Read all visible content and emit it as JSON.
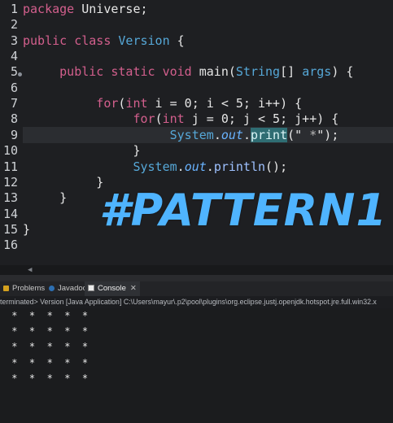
{
  "editor": {
    "lines": [
      {
        "n": "1",
        "segments": [
          {
            "t": "package",
            "c": "kw"
          },
          {
            "t": " Universe;",
            "c": ""
          }
        ]
      },
      {
        "n": "2",
        "segments": []
      },
      {
        "n": "3",
        "segments": [
          {
            "t": "public",
            "c": "kw"
          },
          {
            "t": " ",
            "c": ""
          },
          {
            "t": "class",
            "c": "kw"
          },
          {
            "t": " ",
            "c": ""
          },
          {
            "t": "Version",
            "c": "cls"
          },
          {
            "t": " {",
            "c": ""
          }
        ]
      },
      {
        "n": "4",
        "segments": []
      },
      {
        "n": "5",
        "segments": [
          {
            "t": "     public",
            "c": "kw"
          },
          {
            "t": " ",
            "c": ""
          },
          {
            "t": "static",
            "c": "kw"
          },
          {
            "t": " ",
            "c": ""
          },
          {
            "t": "void",
            "c": "kw"
          },
          {
            "t": " main(",
            "c": ""
          },
          {
            "t": "String",
            "c": "cls"
          },
          {
            "t": "[] ",
            "c": ""
          },
          {
            "t": "args",
            "c": "cls"
          },
          {
            "t": ") {",
            "c": ""
          }
        ]
      },
      {
        "n": "6",
        "segments": []
      },
      {
        "n": "7",
        "segments": [
          {
            "t": "          for",
            "c": "kw"
          },
          {
            "t": "(",
            "c": ""
          },
          {
            "t": "int",
            "c": "kw"
          },
          {
            "t": " i = 0; i < 5; i++) {",
            "c": ""
          }
        ]
      },
      {
        "n": "8",
        "segments": [
          {
            "t": "               for",
            "c": "kw"
          },
          {
            "t": "(",
            "c": ""
          },
          {
            "t": "int",
            "c": "kw"
          },
          {
            "t": " j = 0; j < 5; j++) {",
            "c": ""
          }
        ]
      },
      {
        "n": "9",
        "segments": [
          {
            "t": "                    System",
            "c": "cls"
          },
          {
            "t": ".",
            "c": ""
          },
          {
            "t": "out",
            "c": "fld"
          },
          {
            "t": ".",
            "c": ""
          },
          {
            "t": "print",
            "c": "print-hl"
          },
          {
            "t": "(\"",
            "c": ""
          },
          {
            "t": " *",
            "c": "str"
          },
          {
            "t": "\"",
            "c": ""
          },
          {
            "t": ")",
            "c": ""
          },
          {
            "t": ";",
            "c": ""
          }
        ]
      },
      {
        "n": "10",
        "segments": [
          {
            "t": "               }",
            "c": ""
          }
        ]
      },
      {
        "n": "11",
        "segments": [
          {
            "t": "               System",
            "c": "cls"
          },
          {
            "t": ".",
            "c": ""
          },
          {
            "t": "out",
            "c": "fld"
          },
          {
            "t": ".",
            "c": ""
          },
          {
            "t": "println",
            "c": "fn"
          },
          {
            "t": "();",
            "c": ""
          }
        ]
      },
      {
        "n": "12",
        "segments": [
          {
            "t": "          }",
            "c": ""
          }
        ]
      },
      {
        "n": "13",
        "segments": [
          {
            "t": "     }",
            "c": ""
          }
        ]
      },
      {
        "n": "14",
        "segments": []
      },
      {
        "n": "15",
        "segments": [
          {
            "t": "}",
            "c": ""
          }
        ]
      },
      {
        "n": "16",
        "segments": []
      }
    ]
  },
  "overlay": {
    "title": "#PATTERN1"
  },
  "bottom_panel": {
    "tabs": [
      {
        "label": "Problems",
        "icon": "problems-icon",
        "active": false
      },
      {
        "label": "Javadoc",
        "icon": "javadoc-icon",
        "active": false
      },
      {
        "label": "Console",
        "icon": "console-icon",
        "active": true
      }
    ],
    "status": "terminated> Version [Java Application] C:\\Users\\mayur\\.p2\\pool\\plugins\\org.eclipse.justj.openjdk.hotspot.jre.full.win32.x",
    "output": [
      " *  *  *  *  *",
      " *  *  *  *  *",
      " *  *  *  *  *",
      " *  *  *  *  *",
      " *  *  *  *  *"
    ]
  },
  "colors": {
    "accent": "#4fb4ff",
    "keyword": "#d35f8d",
    "type": "#56a8d8"
  }
}
